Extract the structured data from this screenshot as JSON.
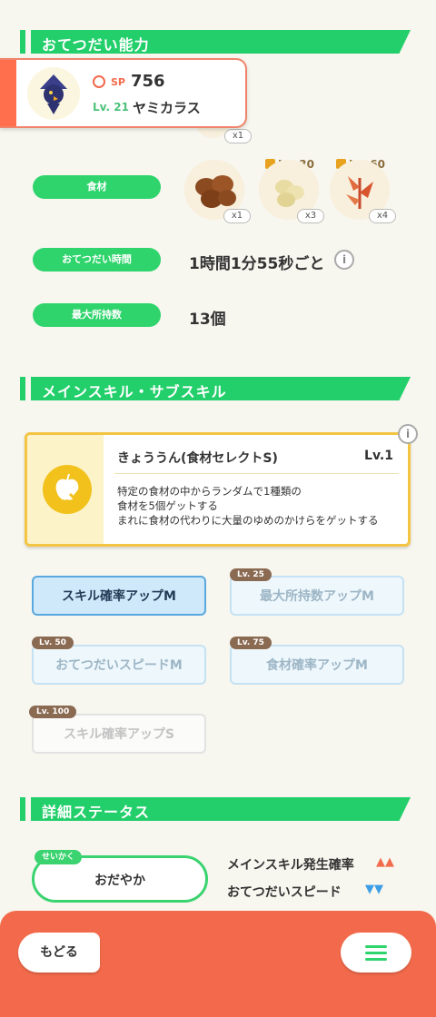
{
  "section1": {
    "title": "おてつだい能力"
  },
  "pokemon": {
    "sp_label": "SP",
    "sp_value": "756",
    "level": "Lv. 21",
    "name": "ヤミカラス",
    "berry_count": "x1"
  },
  "ingredients": {
    "label": "食材",
    "items": [
      {
        "name": "nut-icon",
        "count": "x1",
        "unlock": ""
      },
      {
        "name": "beans-icon",
        "count": "x3",
        "unlock": "Lv. 30"
      },
      {
        "name": "herb-icon",
        "count": "x4",
        "unlock": "Lv. 60"
      }
    ]
  },
  "help_time": {
    "label": "おてつだい時間",
    "value": "1時間1分55秒ごと"
  },
  "max_carry": {
    "label": "最大所持数",
    "value": "13個"
  },
  "section2": {
    "title": "メインスキル・サブスキル"
  },
  "main_skill": {
    "name": "きょううん(食材セレクトS)",
    "level": "Lv.1",
    "desc1": "特定の食材の中からランダムで1種類の",
    "desc2": "食材を5個ゲットする",
    "desc3": "まれに食材の代わりに大量のゆめのかけらをゲットする"
  },
  "subskills": [
    {
      "label": "スキル確率アップM",
      "lock": ""
    },
    {
      "label": "最大所持数アップM",
      "lock": "Lv. 25"
    },
    {
      "label": "おてつだいスピードM",
      "lock": "Lv. 50"
    },
    {
      "label": "食材確率アップM",
      "lock": "Lv. 75"
    },
    {
      "label": "スキル確率アップS",
      "lock": "Lv. 100"
    }
  ],
  "section3": {
    "title": "詳細ステータス"
  },
  "nature": {
    "tag": "せいかく",
    "value": "おだやか"
  },
  "stats": [
    {
      "label": "メインスキル発生確率",
      "arrows": "▲▲",
      "color": "#f36b4d"
    },
    {
      "label": "おてつだいスピード",
      "arrows": "▼▼",
      "color": "#3d9ee6"
    }
  ],
  "footer": {
    "back_label": "もどる"
  },
  "colors": {
    "green": "#23cf6b",
    "orange": "#f26a4b",
    "gold": "#f4c443"
  }
}
